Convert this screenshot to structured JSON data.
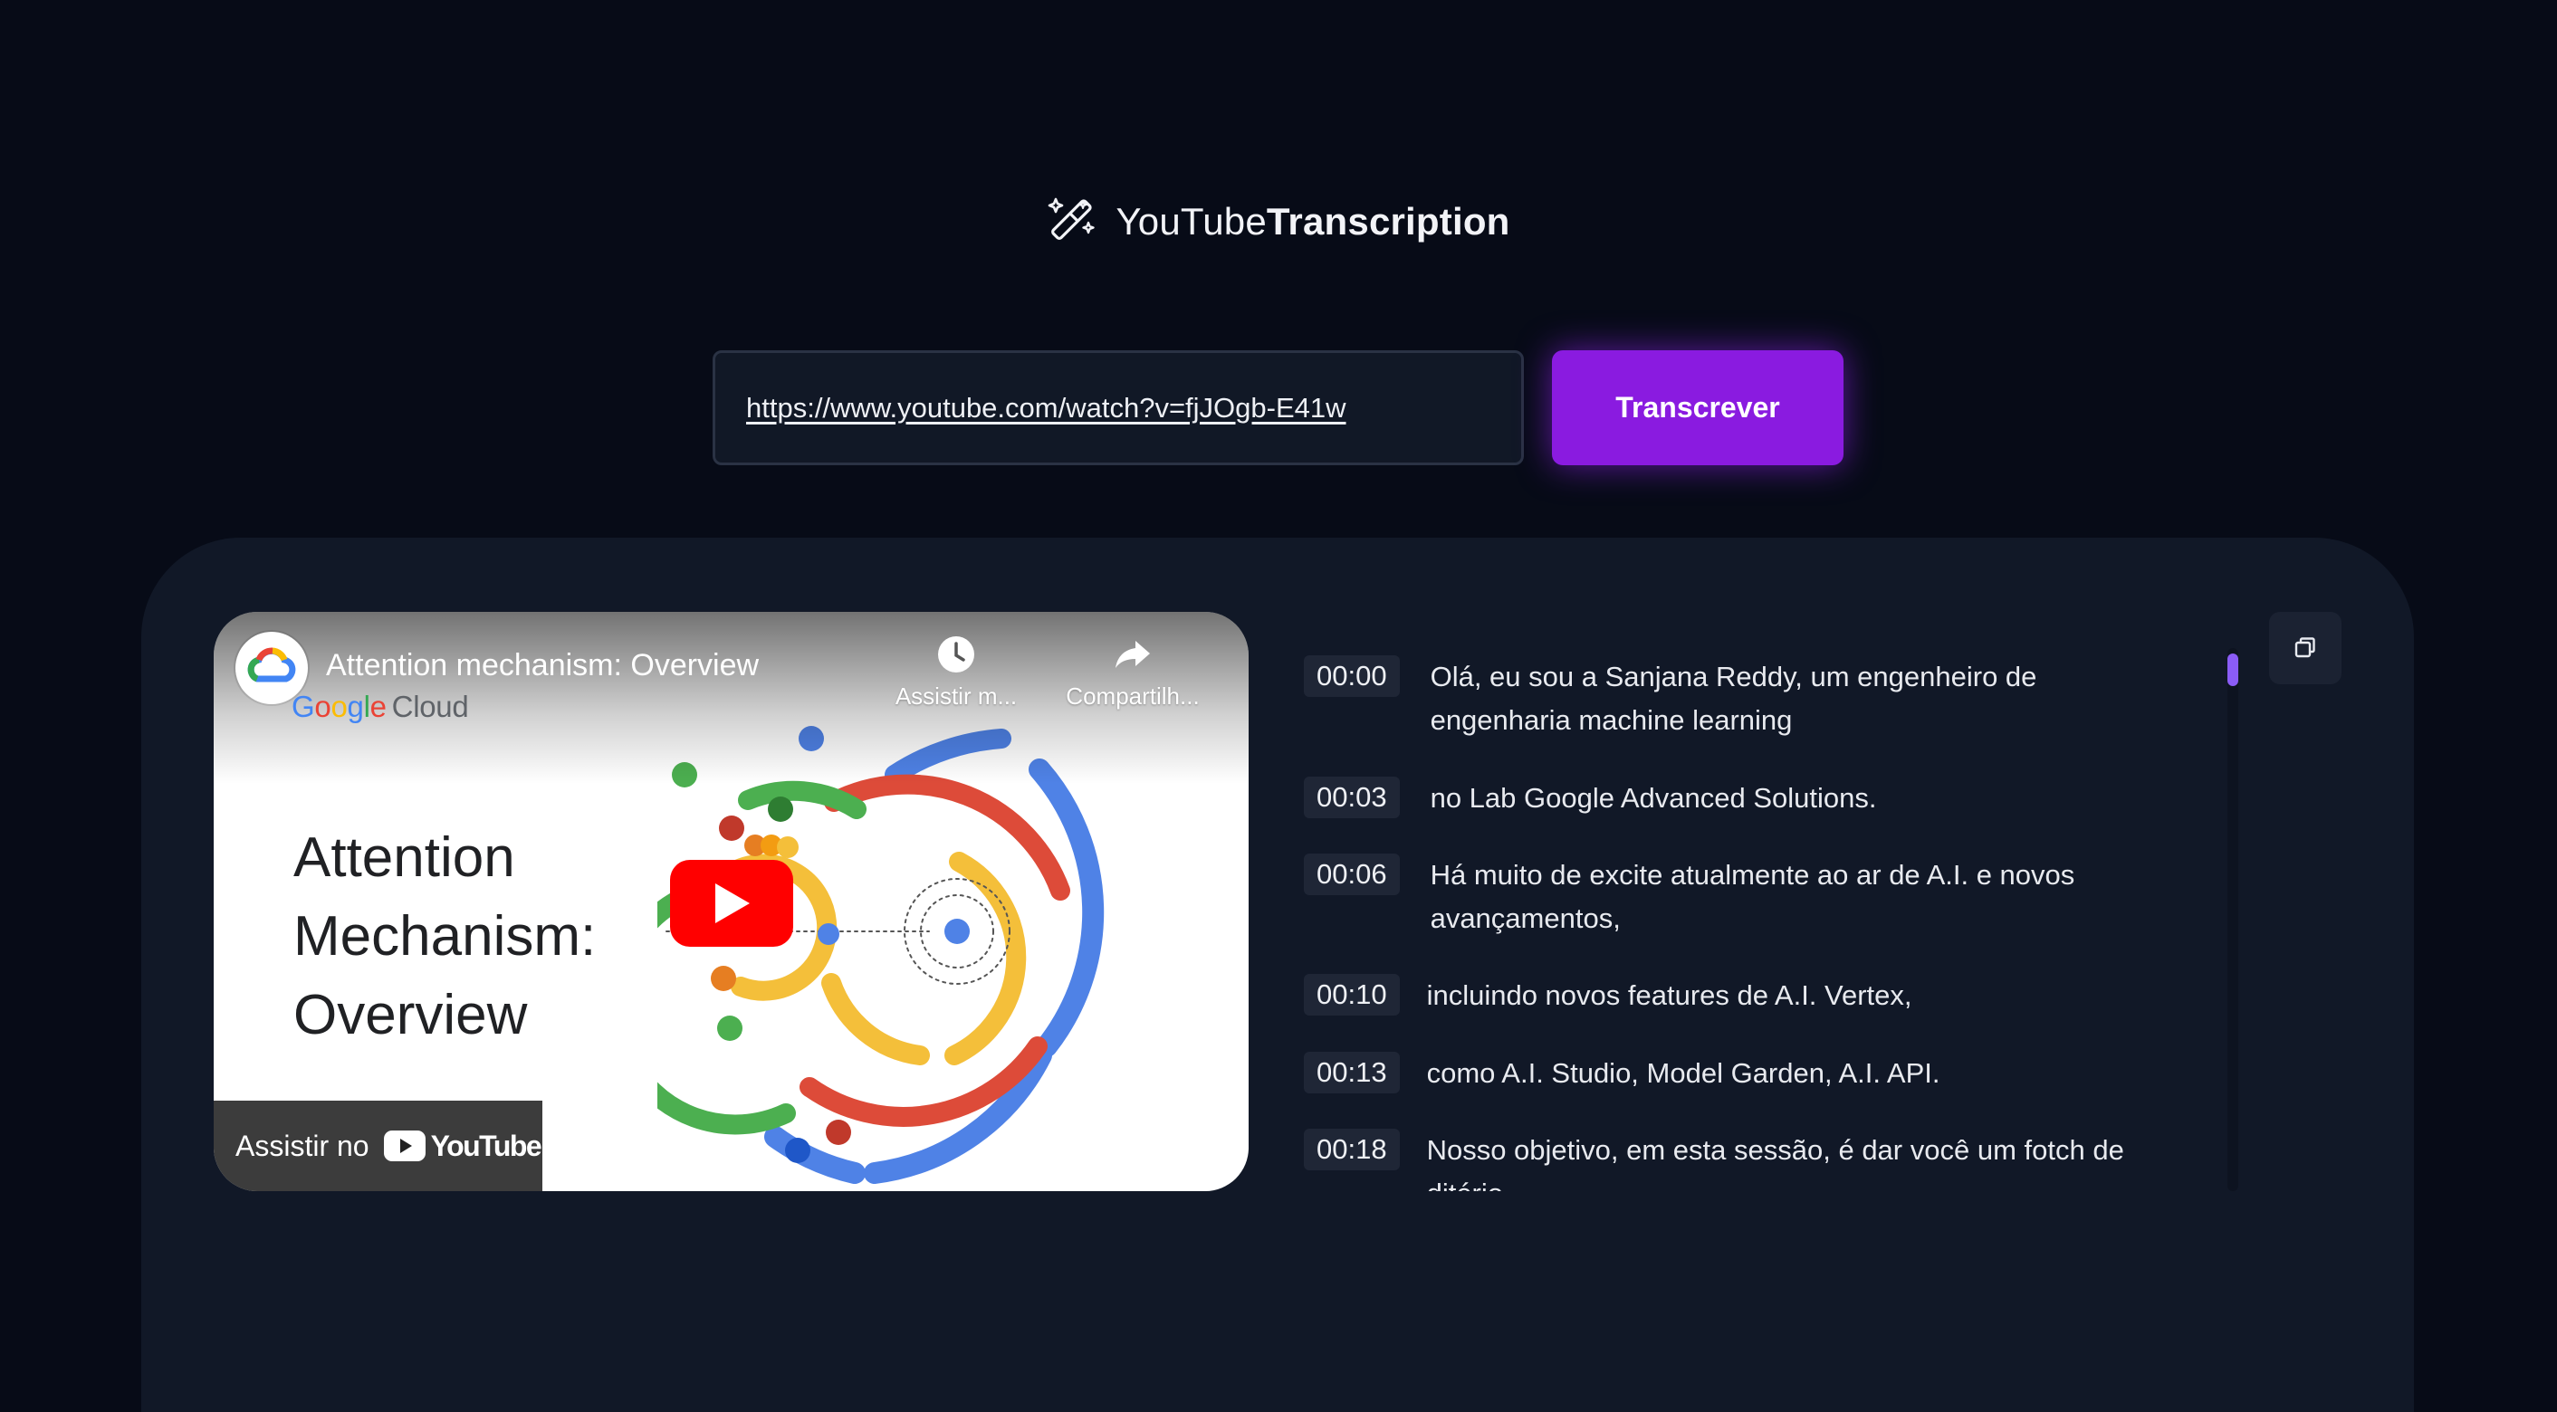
{
  "app": {
    "brand_light": "YouTube",
    "brand_bold": "Transcription",
    "brand_icon": "magic-wand-icon",
    "accent_color": "#8a1be0"
  },
  "form": {
    "url_value": "https://www.youtube.com/watch?v=fjJOgb-E41w",
    "submit_label": "Transcrever"
  },
  "video": {
    "title": "Attention mechanism: Overview",
    "channel_google": "Google",
    "channel_cloud": "Cloud",
    "watch_later_label": "Assistir m...",
    "share_label": "Compartilh...",
    "slide_title_lines": [
      "Attention",
      "Mechanism:",
      "Overview"
    ],
    "watch_on_label": "Assistir no",
    "youtube_word": "YouTube"
  },
  "transcript": {
    "entries": [
      {
        "time": "00:00",
        "text": "Olá, eu  sou a Sanjana  Reddy, um engenheiro  de engenharia machine  learning"
      },
      {
        "time": "00:03",
        "text": "no Lab  Google Advanced Solutions."
      },
      {
        "time": "00:06",
        "text": "Há muito  de excite atualmente  ao ar de  A.I. e novos avançamentos,"
      },
      {
        "time": "00:10",
        "text": "incluindo novos  features de A.I.  Vertex,"
      },
      {
        "time": "00:13",
        "text": "como A.I.  Studio, Model Garden,  A.I. API."
      },
      {
        "time": "00:18",
        "text": "Nosso objetivo,  em esta sessão,  é dar você  um fotch de ditério"
      }
    ],
    "copy_icon": "copy-icon",
    "scroll_progress": 0.0
  }
}
